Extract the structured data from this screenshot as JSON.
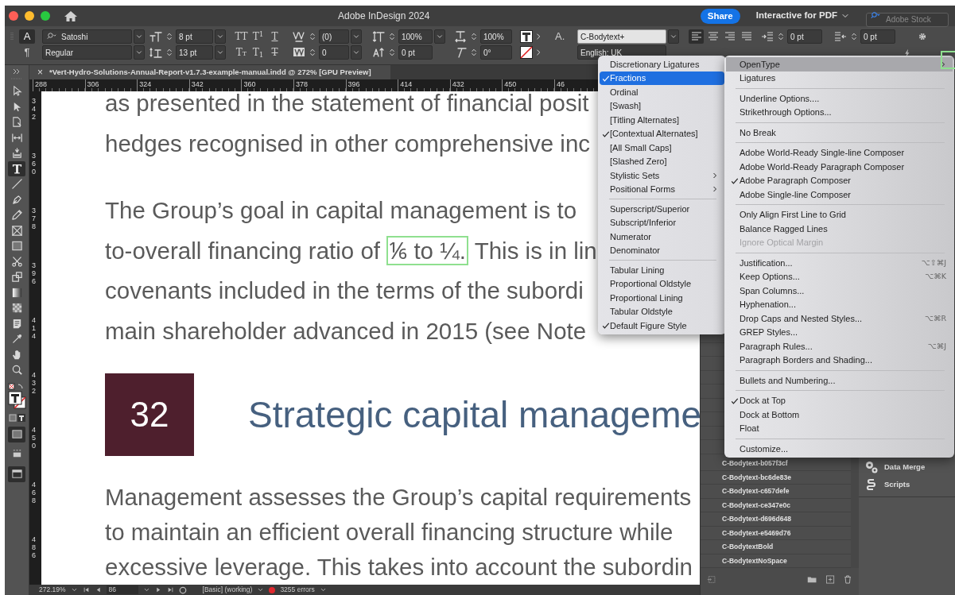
{
  "window": {
    "title": "Adobe InDesign 2024",
    "share_button": "Share",
    "workspace": "Interactive for PDF",
    "search": {
      "placeholder": "Adobe Stock"
    }
  },
  "control_panel": {
    "mode_buttons": [
      {
        "label": "A",
        "selected": true
      },
      {
        "label": "¶",
        "selected": false
      }
    ],
    "font_family": "Satoshi",
    "font_style": "Regular",
    "font_size": "8 pt",
    "leading": "13 pt",
    "style_buttons": [
      {
        "label": "TT",
        "kind": "plain"
      },
      {
        "label": "T$^{1}$",
        "kind": "plain"
      },
      {
        "label": "T",
        "kind": "underline"
      },
      {
        "label": "Tt",
        "kind": "smallcaps"
      },
      {
        "label": "T$_{1}$",
        "kind": "plain"
      },
      {
        "label": "T",
        "kind": "strike"
      }
    ],
    "kerning": "(0)",
    "tracking": "0",
    "vertical_scale": "100%",
    "baseline_shift": "0 pt",
    "horizontal_scale": "100%",
    "skew": "0°",
    "character_style_label": "A.",
    "character_style": "C-Bodytext+",
    "language": "English: UK",
    "align_buttons": [
      {
        "selected": true
      },
      {
        "selected": false
      },
      {
        "selected": false
      },
      {
        "selected": false
      }
    ],
    "left_indent": "0 pt",
    "right_indent": "0 pt"
  },
  "document_tab": {
    "close": "×",
    "title": "*Vert-Hydro-Solutions-Annual-Report-v1.7.3-example-manual.indd @ 272% [GPU Preview]"
  },
  "tools": [
    {
      "kind": "select",
      "selected": false
    },
    {
      "kind": "direct",
      "selected": false
    },
    {
      "kind": "page",
      "selected": false
    },
    {
      "kind": "gap",
      "selected": false
    },
    {
      "kind": "collector",
      "selected": false
    },
    {
      "kind": "type",
      "selected": true
    },
    {
      "kind": "line",
      "selected": false
    },
    {
      "kind": "pen",
      "selected": false
    },
    {
      "kind": "pencil",
      "selected": false
    },
    {
      "kind": "frame",
      "selected": false
    },
    {
      "kind": "rectangle",
      "selected": false
    },
    {
      "kind": "scissors",
      "selected": false
    },
    {
      "kind": "transform",
      "selected": false
    },
    {
      "kind": "gradient",
      "selected": false
    },
    {
      "kind": "feather",
      "selected": false
    },
    {
      "kind": "note",
      "selected": false
    },
    {
      "kind": "eyedropper",
      "selected": false
    },
    {
      "kind": "hand",
      "selected": false
    },
    {
      "kind": "zoom",
      "selected": false
    }
  ],
  "ruler": {
    "horizontal": [
      "288",
      "306",
      "324",
      "342",
      "360",
      "378",
      "396",
      "414",
      "432",
      "450",
      "46"
    ],
    "vertical": [
      "342",
      "360",
      "378",
      "396",
      "414",
      "432",
      "450",
      "468",
      "486"
    ]
  },
  "page": {
    "paragraphs": [
      {
        "lines": [
          {
            "kind": "plain",
            "text": "as presented in the statement of financial posit"
          },
          {
            "kind": "plain",
            "text": "hedges recognised in other comprehensive inc"
          }
        ]
      },
      {
        "lines": [
          {
            "kind": "plain",
            "text": "The Group’s goal in capital management is to"
          },
          {
            "kind": "highlight",
            "text": "to-overall financing ratio of",
            "highlight": "⅙ to ¼.",
            "after": "This is in lin"
          },
          {
            "kind": "plain",
            "text": "covenants included in the terms of the subordi"
          },
          {
            "kind": "plain",
            "text": "main shareholder advanced in 2015 (see Note"
          }
        ]
      },
      {
        "kind": "heading",
        "number": "32",
        "text": "Strategic capital manageme"
      },
      {
        "lines": [
          {
            "kind": "plain",
            "text": "Management assesses the Group’s capital requirements"
          },
          {
            "kind": "plain",
            "text": "to maintain an efficient overall financing structure while"
          },
          {
            "kind": "plain",
            "text": "excessive leverage. This takes into account the subordin"
          }
        ]
      }
    ]
  },
  "styles_panel": {
    "items": [
      "C-Bodytext-b057f3cf",
      "C-Bodytext-bc6de83e",
      "C-Bodytext-c657defe",
      "C-Bodytext-ce347e0c",
      "C-Bodytext-d696d648",
      "C-Bodytext-e5469d76",
      "C-BodytextBold",
      "C-BodytextNoSpace"
    ]
  },
  "side_panel": {
    "items": [
      {
        "kind": "data-merge",
        "label": "Data Merge"
      },
      {
        "kind": "scripts",
        "label": "Scripts"
      }
    ]
  },
  "status_bar": {
    "zoom": "272.19%",
    "page": "86",
    "preflight_profile": "[Basic] (working)",
    "errors": "3255 errors"
  },
  "menus": [
    {
      "items": [
        {
          "kind": "item",
          "label": "Discretionary Ligatures",
          "checked": false,
          "selected": false
        },
        {
          "kind": "item",
          "label": "Fractions",
          "checked": true,
          "selected": true
        },
        {
          "kind": "item",
          "label": "Ordinal",
          "checked": false,
          "selected": false
        },
        {
          "kind": "item",
          "label": "[Swash]",
          "checked": false,
          "selected": false
        },
        {
          "kind": "item",
          "label": "[Titling Alternates]",
          "checked": false,
          "selected": false
        },
        {
          "kind": "item",
          "label": "[Contextual Alternates]",
          "checked": true,
          "selected": false
        },
        {
          "kind": "item",
          "label": "[All Small Caps]",
          "checked": false,
          "selected": false
        },
        {
          "kind": "item",
          "label": "[Slashed Zero]",
          "checked": false,
          "selected": false
        },
        {
          "kind": "item",
          "label": "Stylistic Sets",
          "checked": false,
          "selected": false,
          "submenu": true
        },
        {
          "kind": "item",
          "label": "Positional Forms",
          "checked": false,
          "selected": false,
          "submenu": true
        },
        {
          "kind": "separator"
        },
        {
          "kind": "item",
          "label": "Superscript/Superior",
          "checked": false,
          "selected": false
        },
        {
          "kind": "item",
          "label": "Subscript/Inferior",
          "checked": false,
          "selected": false
        },
        {
          "kind": "item",
          "label": "Numerator",
          "checked": false,
          "selected": false
        },
        {
          "kind": "item",
          "label": "Denominator",
          "checked": false,
          "selected": false
        },
        {
          "kind": "separator"
        },
        {
          "kind": "item",
          "label": "Tabular Lining",
          "checked": false,
          "selected": false
        },
        {
          "kind": "item",
          "label": "Proportional Oldstyle",
          "checked": false,
          "selected": false
        },
        {
          "kind": "item",
          "label": "Proportional Lining",
          "checked": false,
          "selected": false
        },
        {
          "kind": "item",
          "label": "Tabular Oldstyle",
          "checked": false,
          "selected": false
        },
        {
          "kind": "item",
          "label": "Default Figure Style",
          "checked": true,
          "selected": false
        }
      ]
    },
    {
      "items": [
        {
          "kind": "item",
          "label": "OpenType",
          "checked": false,
          "selected": true,
          "submenu": true
        },
        {
          "kind": "item",
          "label": "Ligatures",
          "checked": false,
          "selected": false
        },
        {
          "kind": "separator"
        },
        {
          "kind": "item",
          "label": "Underline Options....",
          "checked": false,
          "selected": false
        },
        {
          "kind": "item",
          "label": "Strikethrough Options...",
          "checked": false,
          "selected": false
        },
        {
          "kind": "separator"
        },
        {
          "kind": "item",
          "label": "No Break",
          "checked": false,
          "selected": false
        },
        {
          "kind": "separator"
        },
        {
          "kind": "item",
          "label": "Adobe World-Ready Single-line Composer",
          "checked": false,
          "selected": false
        },
        {
          "kind": "item",
          "label": "Adobe World-Ready Paragraph Composer",
          "checked": false,
          "selected": false
        },
        {
          "kind": "item",
          "label": "Adobe Paragraph Composer",
          "checked": true,
          "selected": false
        },
        {
          "kind": "item",
          "label": "Adobe Single-line Composer",
          "checked": false,
          "selected": false
        },
        {
          "kind": "separator"
        },
        {
          "kind": "item",
          "label": "Only Align First Line to Grid",
          "checked": false,
          "selected": false
        },
        {
          "kind": "item",
          "label": "Balance Ragged Lines",
          "checked": false,
          "selected": false
        },
        {
          "kind": "item",
          "label": "Ignore Optical Margin",
          "checked": false,
          "selected": false,
          "disabled": true
        },
        {
          "kind": "separator"
        },
        {
          "kind": "item",
          "label": "Justification...",
          "checked": false,
          "selected": false,
          "shortcut": "⌥⇧⌘J"
        },
        {
          "kind": "item",
          "label": "Keep Options...",
          "checked": false,
          "selected": false,
          "shortcut": "⌥⌘K"
        },
        {
          "kind": "item",
          "label": "Span Columns...",
          "checked": false,
          "selected": false
        },
        {
          "kind": "item",
          "label": "Hyphenation...",
          "checked": false,
          "selected": false
        },
        {
          "kind": "item",
          "label": "Drop Caps and Nested Styles...",
          "checked": false,
          "selected": false,
          "shortcut": "⌥⌘R"
        },
        {
          "kind": "item",
          "label": "GREP Styles...",
          "checked": false,
          "selected": false
        },
        {
          "kind": "item",
          "label": "Paragraph Rules...",
          "checked": false,
          "selected": false,
          "shortcut": "⌥⌘J"
        },
        {
          "kind": "item",
          "label": "Paragraph Borders and Shading...",
          "checked": false,
          "selected": false
        },
        {
          "kind": "separator"
        },
        {
          "kind": "item",
          "label": "Bullets and Numbering...",
          "checked": false,
          "selected": false
        },
        {
          "kind": "separator"
        },
        {
          "kind": "item",
          "label": "Dock at Top",
          "checked": true,
          "selected": false
        },
        {
          "kind": "item",
          "label": "Dock at Bottom",
          "checked": false,
          "selected": false
        },
        {
          "kind": "item",
          "label": "Float",
          "checked": false,
          "selected": false
        },
        {
          "kind": "separator"
        },
        {
          "kind": "item",
          "label": "Customize...",
          "checked": false,
          "selected": false
        }
      ]
    }
  ]
}
